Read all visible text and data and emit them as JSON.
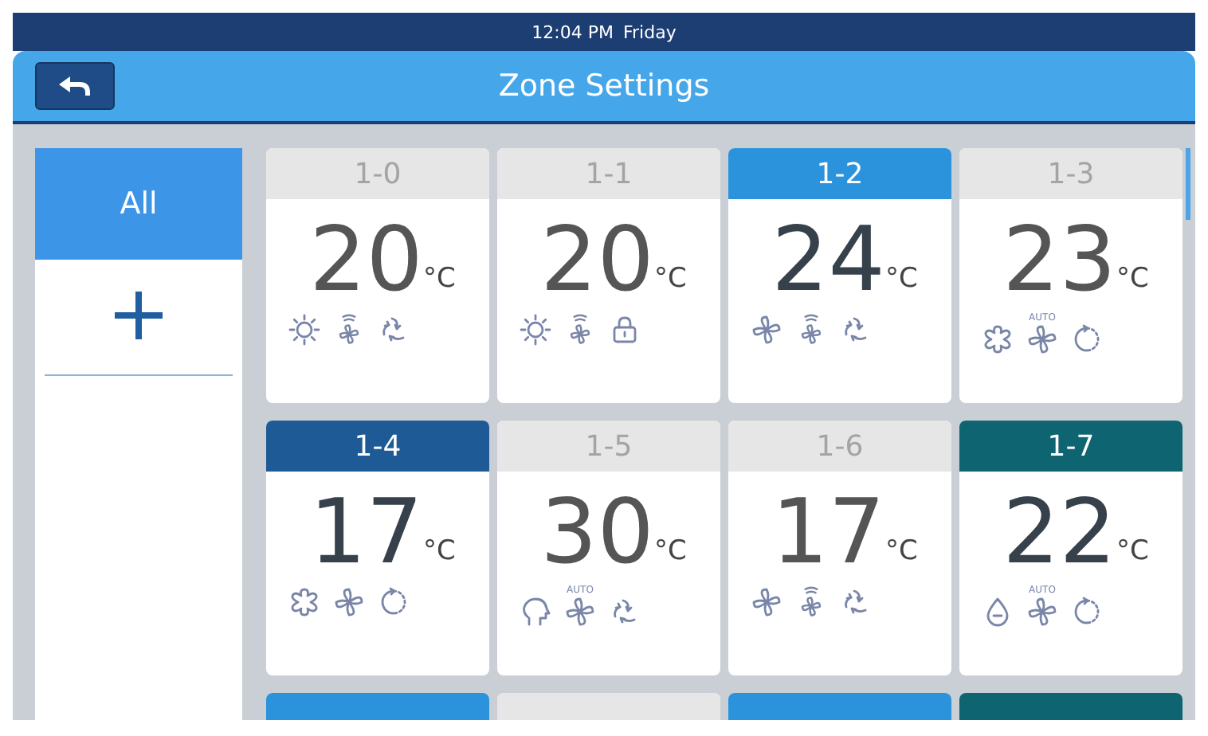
{
  "status_bar": {
    "time": "12:04 PM",
    "day": "Friday"
  },
  "header": {
    "title": "Zone Settings"
  },
  "sidebar": {
    "items": [
      {
        "kind": "text",
        "label": "All",
        "selected": true
      },
      {
        "kind": "add",
        "selected": false
      }
    ]
  },
  "zones": [
    {
      "label": "1-0",
      "on": false,
      "temperature": "20",
      "unit": "°C",
      "icons": [
        {
          "kind": "sun"
        },
        {
          "kind": "fan-waves"
        },
        {
          "kind": "swirl"
        }
      ]
    },
    {
      "label": "1-1",
      "on": false,
      "temperature": "20",
      "unit": "°C",
      "icons": [
        {
          "kind": "sun"
        },
        {
          "kind": "fan-waves"
        },
        {
          "kind": "lock"
        }
      ]
    },
    {
      "label": "1-2",
      "on": true,
      "color": "#2b93dc",
      "temperature": "24",
      "unit": "°C",
      "icons": [
        {
          "kind": "fan"
        },
        {
          "kind": "fan-waves"
        },
        {
          "kind": "swirl"
        }
      ]
    },
    {
      "label": "1-3",
      "on": false,
      "temperature": "23",
      "unit": "°C",
      "icons": [
        {
          "kind": "snowflake"
        },
        {
          "kind": "fan",
          "badge": "AUTO"
        },
        {
          "kind": "cycle"
        }
      ]
    },
    {
      "label": "1-4",
      "on": true,
      "color": "#1e5a95",
      "temperature": "17",
      "unit": "°C",
      "icons": [
        {
          "kind": "snowflake"
        },
        {
          "kind": "fan"
        },
        {
          "kind": "cycle"
        }
      ]
    },
    {
      "label": "1-5",
      "on": false,
      "temperature": "30",
      "unit": "°C",
      "icons": [
        {
          "kind": "head"
        },
        {
          "kind": "fan",
          "badge": "AUTO"
        },
        {
          "kind": "swirl"
        }
      ]
    },
    {
      "label": "1-6",
      "on": false,
      "temperature": "17",
      "unit": "°C",
      "icons": [
        {
          "kind": "fan"
        },
        {
          "kind": "fan-waves"
        },
        {
          "kind": "swirl"
        }
      ]
    },
    {
      "label": "1-7",
      "on": true,
      "color": "#0e6470",
      "temperature": "22",
      "unit": "°C",
      "icons": [
        {
          "kind": "drop"
        },
        {
          "kind": "fan",
          "badge": "AUTO"
        },
        {
          "kind": "cycle"
        }
      ]
    },
    {
      "on": true,
      "color": "#2b93dc"
    },
    {
      "on": false
    },
    {
      "on": true,
      "color": "#2b93dc"
    },
    {
      "on": true,
      "color": "#0e6470"
    }
  ]
}
